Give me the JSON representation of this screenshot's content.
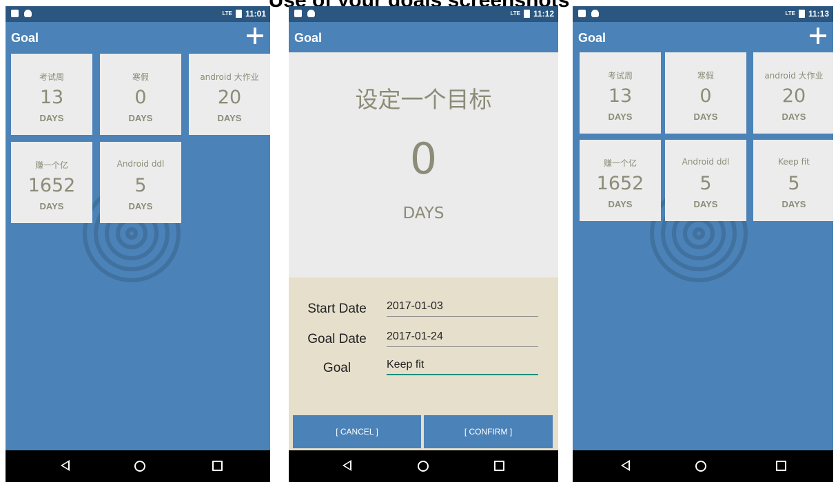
{
  "caption": "Use of your goals screenshots",
  "screens": [
    {
      "status_time": "11:01",
      "app_title": "Goal",
      "goals": [
        {
          "title": "考试周",
          "days": "13",
          "unit": "DAYS"
        },
        {
          "title": "寒假",
          "days": "0",
          "unit": "DAYS"
        },
        {
          "title": "android 大作业",
          "days": "20",
          "unit": "DAYS"
        },
        {
          "title": "赚一个亿",
          "days": "1652",
          "unit": "DAYS"
        },
        {
          "title": "Android ddl",
          "days": "5",
          "unit": "DAYS"
        }
      ]
    },
    {
      "status_time": "11:12",
      "app_title": "Goal",
      "dialog": {
        "title": "设定一个目标",
        "days": "0",
        "unit": "DAYS",
        "start_label": "Start Date",
        "start_value": "2017-01-03",
        "goal_date_label": "Goal Date",
        "goal_date_value": "2017-01-24",
        "goal_label": "Goal",
        "goal_value": "Keep fit",
        "cancel_label": "[ CANCEL ]",
        "confirm_label": "[ CONFIRM ]"
      }
    },
    {
      "status_time": "11:13",
      "app_title": "Goal",
      "goals": [
        {
          "title": "考试周",
          "days": "13",
          "unit": "DAYS"
        },
        {
          "title": "寒假",
          "days": "0",
          "unit": "DAYS"
        },
        {
          "title": "android 大作业",
          "days": "20",
          "unit": "DAYS"
        },
        {
          "title": "赚一个亿",
          "days": "1652",
          "unit": "DAYS"
        },
        {
          "title": "Android ddl",
          "days": "5",
          "unit": "DAYS"
        },
        {
          "title": "Keep fit",
          "days": "5",
          "unit": "DAYS"
        }
      ]
    }
  ],
  "status_signal": "LTE",
  "colors": {
    "app_blue": "#4b82b8",
    "status_bar": "#2a5680",
    "card": "#ececec",
    "card_text": "#8c8c78",
    "form_bg": "#e5dfcc",
    "focus_underline": "#1e8d7c"
  },
  "icons": [
    "add-icon",
    "spiral-icon",
    "nav-back-icon",
    "nav-home-icon",
    "nav-recent-icon"
  ]
}
